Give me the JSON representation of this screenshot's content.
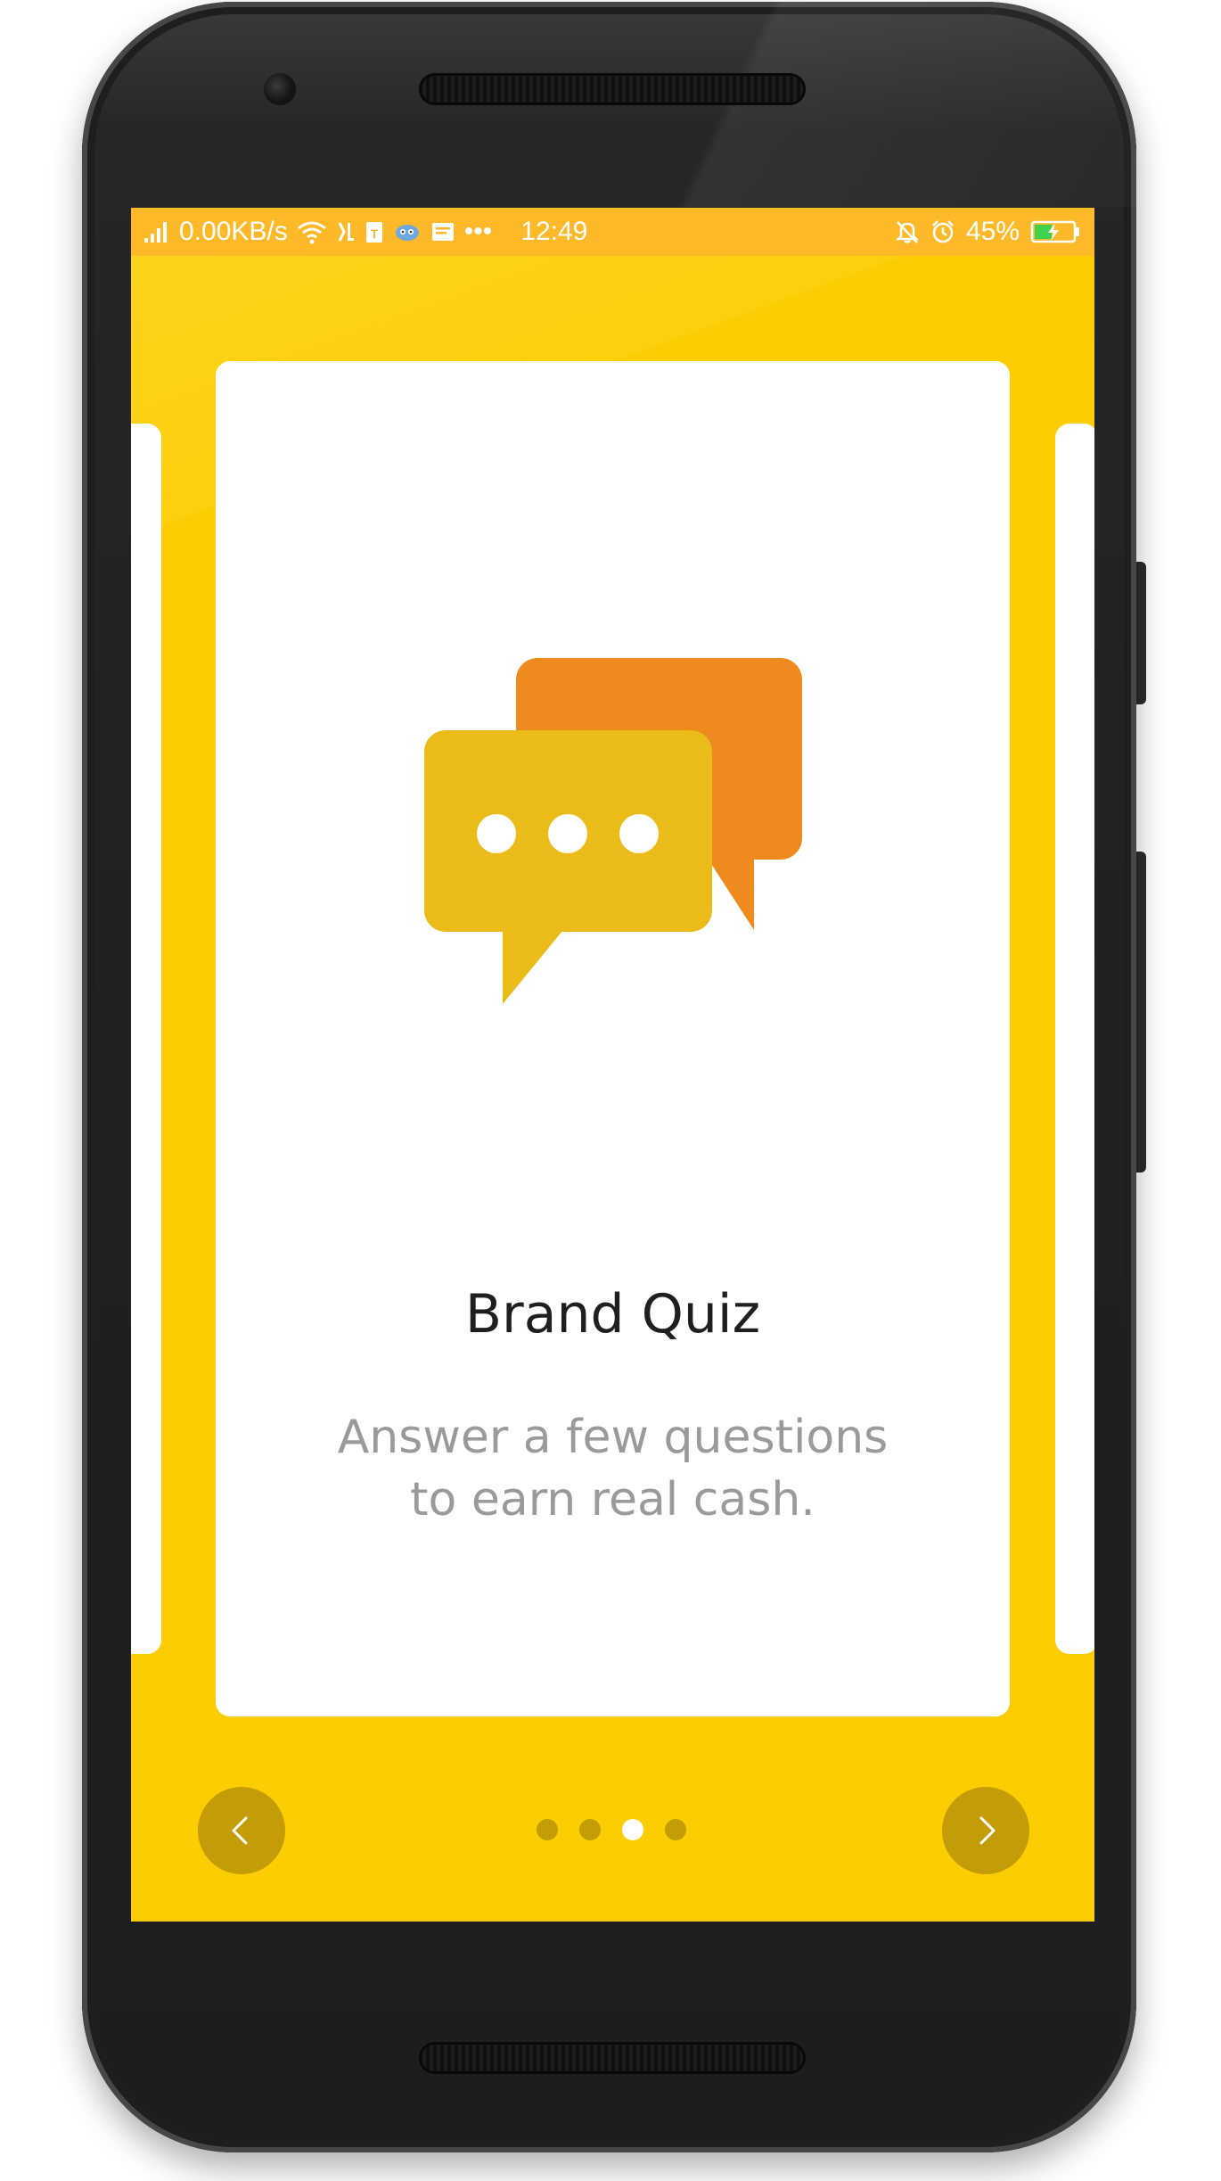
{
  "status_bar": {
    "network_speed": "0.00KB/s",
    "time": "12:49",
    "battery_percent": "45%",
    "battery_level": 0.45,
    "overflow": "•••",
    "icons": [
      "signal-icon",
      "wifi-icon",
      "usb-debug-icon",
      "sim-icon",
      "app-notification-icon",
      "message-icon",
      "mute-icon",
      "alarm-icon",
      "battery-charging-icon"
    ]
  },
  "card": {
    "title": "Brand Quiz",
    "description_line1": "Answer a few questions",
    "description_line2": "to earn real cash.",
    "icon": "chat-bubbles-icon"
  },
  "navigation": {
    "prev_icon": "chevron-left-icon",
    "next_icon": "chevron-right-icon",
    "page_count": 4,
    "active_page_index": 2
  },
  "colors": {
    "background": "#fdcd01",
    "status_bar": "#feb928",
    "card": "#ffffff",
    "nav_button": "#c39c07",
    "dot_inactive": "#c39c07",
    "dot_active": "#ffffff",
    "bubble_front": "#ebbb1a",
    "bubble_back": "#ef8b1e",
    "title_text": "#1f1f1f",
    "description_text": "#9a9a9a",
    "phone_body": "#202020"
  }
}
